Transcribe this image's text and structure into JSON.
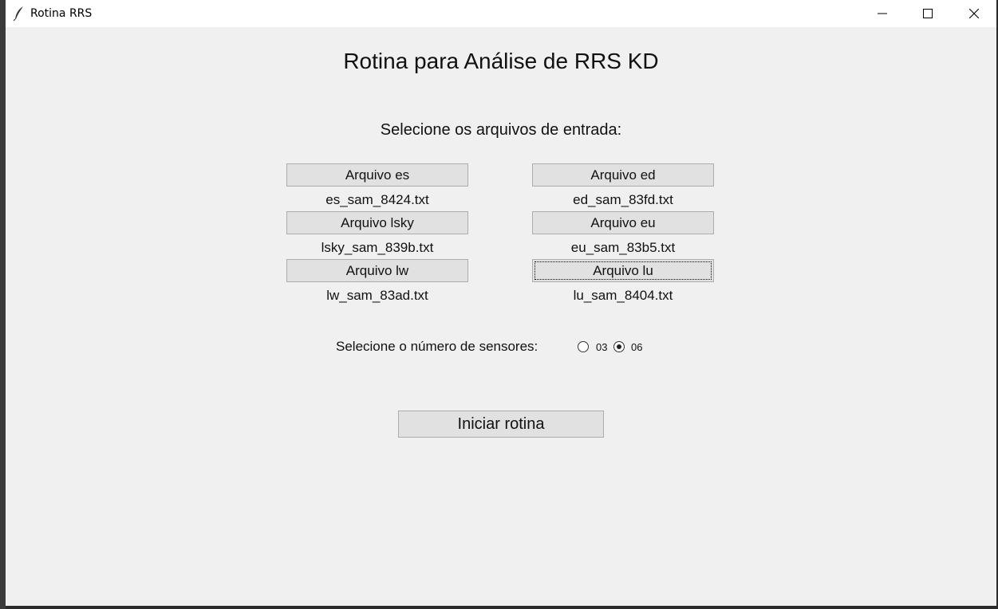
{
  "window": {
    "title": "Rotina RRS",
    "icon": "feather-icon",
    "controls": [
      "minimize-icon",
      "maximize-icon",
      "close-icon"
    ]
  },
  "main": {
    "title": "Rotina para Análise de RRS KD",
    "subtitle": "Selecione os arquivos de entrada:",
    "files": [
      {
        "button": "Arquivo es",
        "file": "es_sam_8424.txt"
      },
      {
        "button": "Arquivo ed",
        "file": "ed_sam_83fd.txt"
      },
      {
        "button": "Arquivo lsky",
        "file": "lsky_sam_839b.txt"
      },
      {
        "button": "Arquivo eu",
        "file": "eu_sam_83b5.txt"
      },
      {
        "button": "Arquivo lw",
        "file": "lw_sam_83ad.txt"
      },
      {
        "button": "Arquivo lu",
        "file": "lu_sam_8404.txt"
      }
    ],
    "sensors": {
      "label": "Selecione o número de sensores:",
      "options": [
        "03",
        "06"
      ],
      "selected": "06"
    },
    "start_button": "Iniciar rotina"
  }
}
